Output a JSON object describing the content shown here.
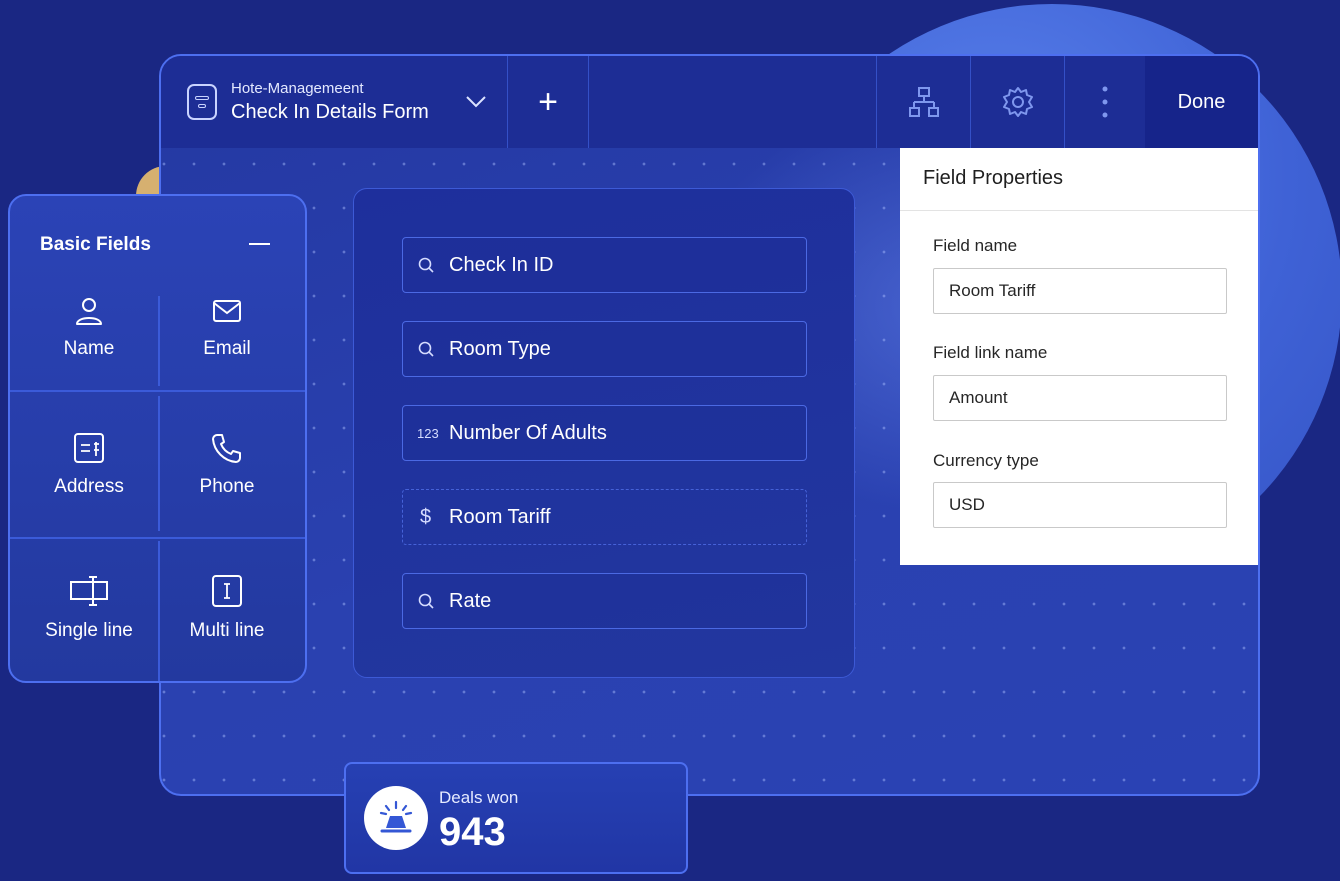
{
  "colors": {
    "background": "#1a2783",
    "window_border": "#4d6ff0",
    "toolbar": "#1d2d95",
    "circle": "#4a6fe3",
    "panel_white": "#ffffff",
    "accent_yellow": "#d6b070"
  },
  "toolbar": {
    "app_name": "Hote-Managemeent",
    "form_name": "Check In Details Form",
    "form_icon": "form-icon",
    "dropdown_icon": "chevron-down-icon",
    "add_icon": "plus-icon",
    "add_label": "+",
    "flow_icon": "workflow-icon",
    "settings_icon": "gear-icon",
    "more_icon": "more-vertical-icon",
    "done_label": "Done"
  },
  "form": {
    "fields": [
      {
        "icon": "search-icon",
        "label": "Check In ID"
      },
      {
        "icon": "search-icon",
        "label": "Room Type"
      },
      {
        "icon": "number-icon",
        "icon_text": "123",
        "label": "Number Of Adults"
      },
      {
        "icon": "dollar-icon",
        "icon_text": "$",
        "label": "Room Tariff"
      },
      {
        "icon": "search-icon",
        "label": "Rate"
      }
    ]
  },
  "field_properties": {
    "title": "Field Properties",
    "field_name_label": "Field name",
    "field_name_value": "Room Tariff",
    "field_link_label": "Field link name",
    "field_link_value": "Amount",
    "currency_label": "Currency type",
    "currency_value": "USD"
  },
  "basic_fields": {
    "title": "Basic Fields",
    "collapse_icon": "minus-icon",
    "items": [
      {
        "label": "Name",
        "icon": "user-icon"
      },
      {
        "label": "Email",
        "icon": "envelope-icon"
      },
      {
        "label": "Address",
        "icon": "address-icon"
      },
      {
        "label": "Phone",
        "icon": "phone-icon"
      },
      {
        "label": "Single line",
        "icon": "single-line-icon"
      },
      {
        "label": "Multi line",
        "icon": "multi-line-icon"
      }
    ]
  },
  "deals": {
    "label": "Deals won",
    "value": "943",
    "icon": "trophy-icon"
  }
}
